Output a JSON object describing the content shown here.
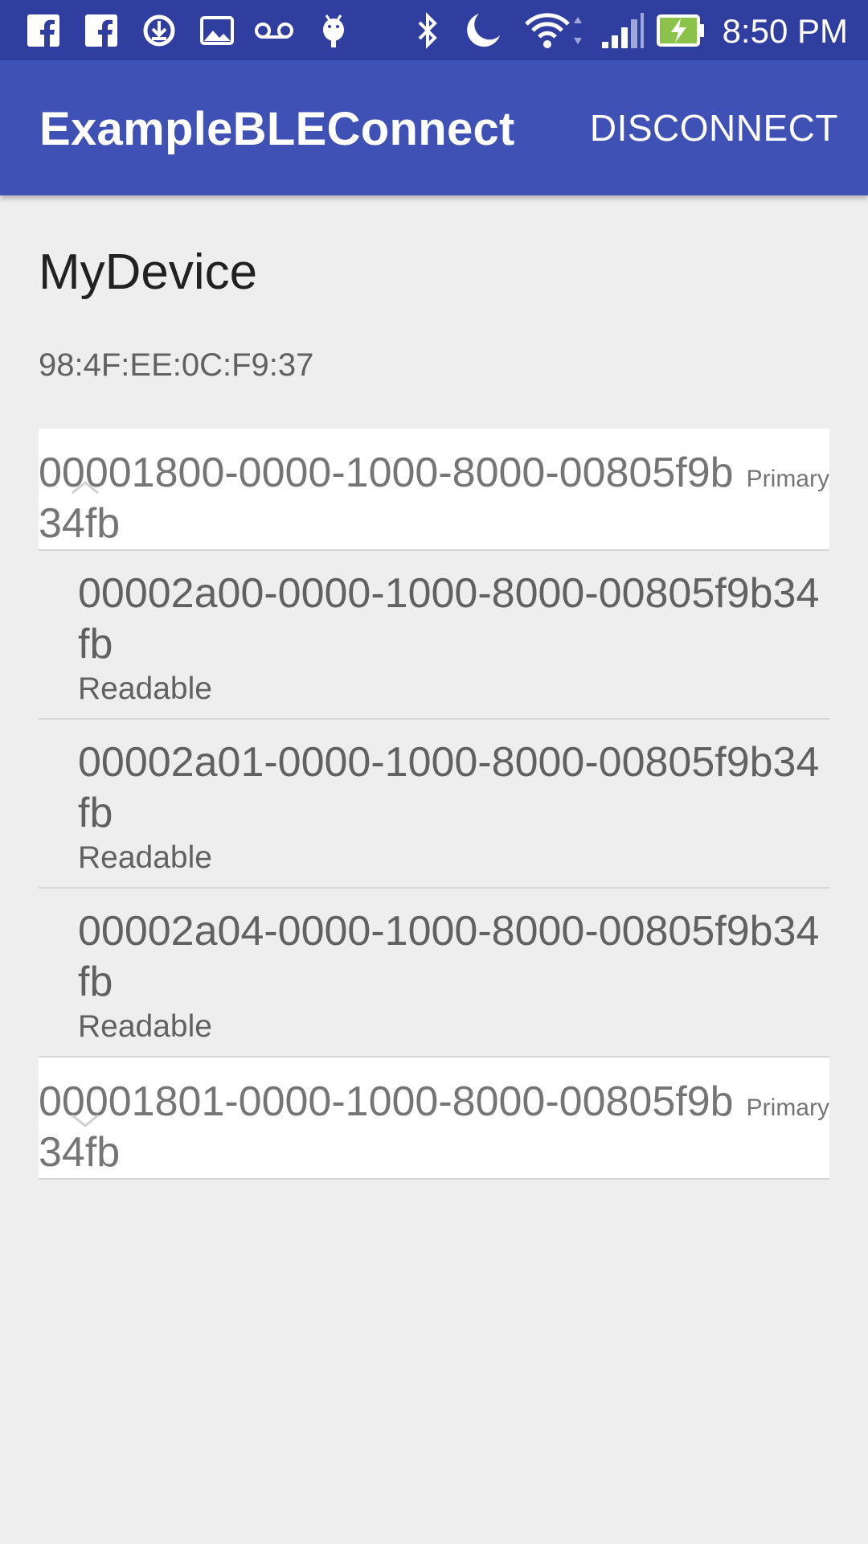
{
  "status_bar": {
    "time": "8:50 PM",
    "icons": [
      "facebook-icon",
      "facebook-icon",
      "download-icon",
      "image-icon",
      "voicemail-icon",
      "android-debug-icon",
      "bluetooth-icon",
      "do-not-disturb-moon-icon",
      "wifi-icon",
      "cell-signal-icon",
      "battery-charging-icon"
    ]
  },
  "app_bar": {
    "title": "ExampleBLEConnect",
    "action": "DISCONNECT"
  },
  "device": {
    "name": "MyDevice",
    "address": "98:4F:EE:0C:F9:37"
  },
  "services": [
    {
      "uuid": "00001800-0000-1000-8000-00805f9b34fb",
      "type": "Primary",
      "expanded": true,
      "characteristics": [
        {
          "uuid": "00002a00-0000-1000-8000-00805f9b34fb",
          "property": "Readable"
        },
        {
          "uuid": "00002a01-0000-1000-8000-00805f9b34fb",
          "property": "Readable"
        },
        {
          "uuid": "00002a04-0000-1000-8000-00805f9b34fb",
          "property": "Readable"
        }
      ]
    },
    {
      "uuid": "00001801-0000-1000-8000-00805f9b34fb",
      "type": "Primary",
      "expanded": false,
      "characteristics": []
    }
  ],
  "colors": {
    "status_bar": "#303f9f",
    "app_bar": "#3f51b5",
    "background": "#eeeeee",
    "row_background": "#ffffff"
  }
}
